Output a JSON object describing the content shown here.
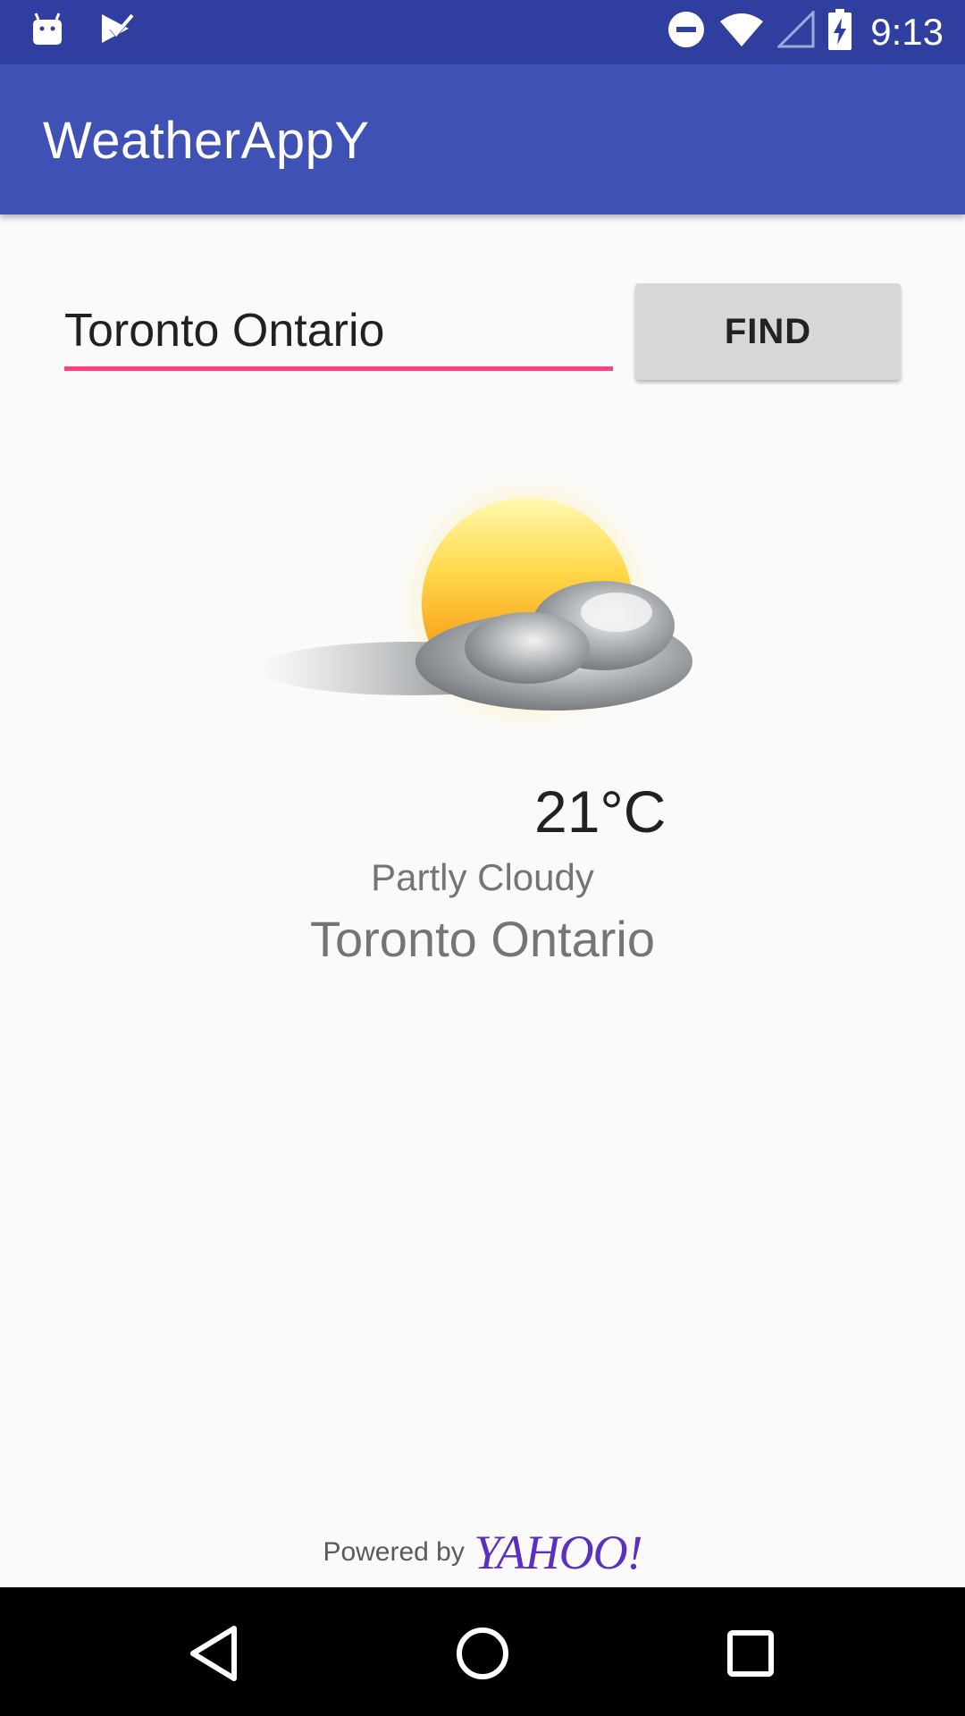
{
  "status_bar": {
    "time": "9:13",
    "icons": [
      "android-notification-icon",
      "task-check-icon",
      "do-not-disturb-icon",
      "wifi-icon",
      "cell-signal-icon",
      "battery-charging-icon"
    ]
  },
  "app_bar": {
    "title": "WeatherAppY",
    "color": "#3f51b5",
    "status_color": "#303f9f"
  },
  "search": {
    "value": "Toronto Ontario",
    "button_label": "FIND",
    "accent": "#ff4081"
  },
  "weather": {
    "icon": "partly-cloudy-icon",
    "temperature": "21°C",
    "condition": "Partly Cloudy",
    "location": "Toronto Ontario"
  },
  "footer": {
    "powered_by": "Powered by",
    "brand": "YAHOO!",
    "brand_color": "#5b2fc2"
  },
  "nav_bar": {
    "buttons": [
      "back-icon",
      "home-icon",
      "recents-icon"
    ]
  }
}
